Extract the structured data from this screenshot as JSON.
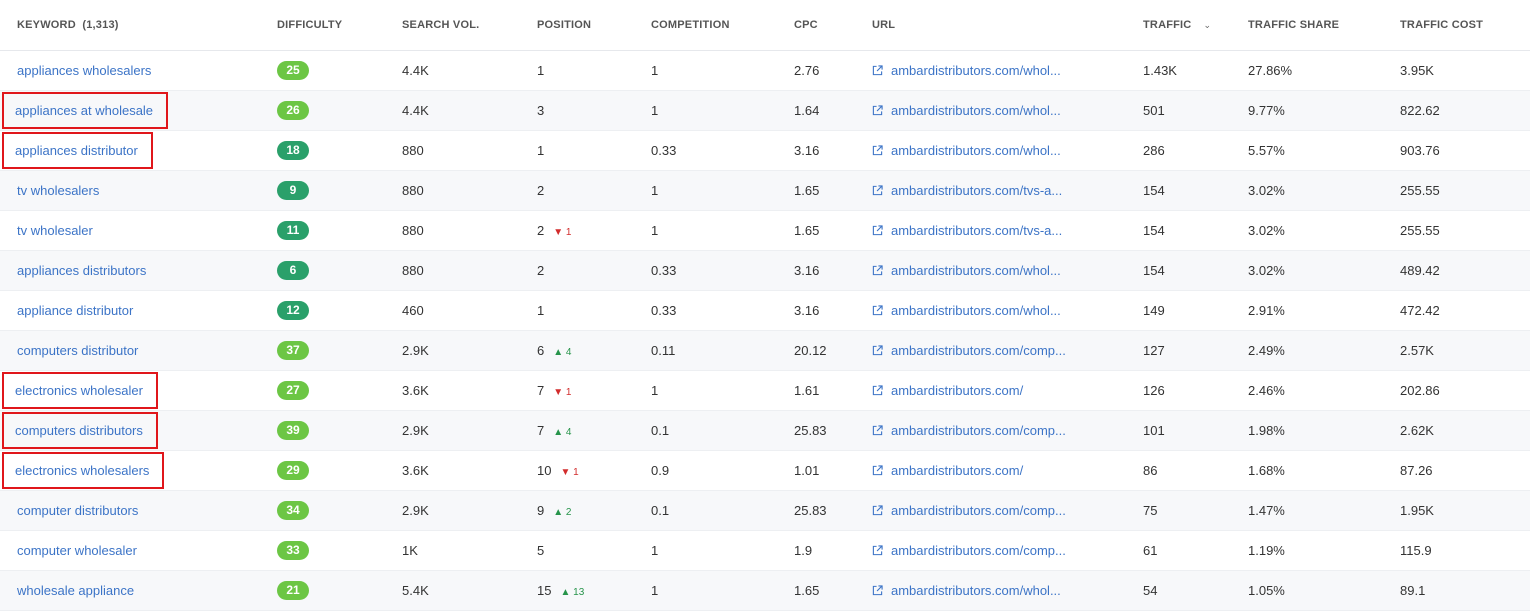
{
  "colors": {
    "accent": "#3c74c7",
    "highlight_box": "#e0161b",
    "difficulty_light": "#6cc644",
    "difficulty_dark": "#2aa06a",
    "up": "#26944a",
    "down": "#d22c2c"
  },
  "table": {
    "headers": {
      "keyword": "KEYWORD",
      "keyword_count": "(1,313)",
      "difficulty": "DIFFICULTY",
      "search_vol": "SEARCH VOL.",
      "position": "POSITION",
      "competition": "COMPETITION",
      "cpc": "CPC",
      "url": "URL",
      "traffic": "TRAFFIC",
      "traffic_share": "TRAFFIC SHARE",
      "traffic_cost": "TRAFFIC COST"
    },
    "sort_icon": "chevron-down-icon",
    "rows": [
      {
        "keyword": "appliances wholesalers",
        "difficulty": "25",
        "level": "light",
        "volume": "4.4K",
        "position": "1",
        "delta": "",
        "dir": "",
        "competition": "1",
        "cpc": "2.76",
        "url": "ambardistributors.com/whol...",
        "traffic": "1.43K",
        "share": "27.86%",
        "cost": "3.95K",
        "highlighted": false
      },
      {
        "keyword": "appliances at wholesale",
        "difficulty": "26",
        "level": "light",
        "volume": "4.4K",
        "position": "3",
        "delta": "",
        "dir": "",
        "competition": "1",
        "cpc": "1.64",
        "url": "ambardistributors.com/whol...",
        "traffic": "501",
        "share": "9.77%",
        "cost": "822.62",
        "highlighted": true
      },
      {
        "keyword": "appliances distributor",
        "difficulty": "18",
        "level": "dark",
        "volume": "880",
        "position": "1",
        "delta": "",
        "dir": "",
        "competition": "0.33",
        "cpc": "3.16",
        "url": "ambardistributors.com/whol...",
        "traffic": "286",
        "share": "5.57%",
        "cost": "903.76",
        "highlighted": true
      },
      {
        "keyword": "tv wholesalers",
        "difficulty": "9",
        "level": "dark",
        "volume": "880",
        "position": "2",
        "delta": "",
        "dir": "",
        "competition": "1",
        "cpc": "1.65",
        "url": "ambardistributors.com/tvs-a...",
        "traffic": "154",
        "share": "3.02%",
        "cost": "255.55",
        "highlighted": false
      },
      {
        "keyword": "tv wholesaler",
        "difficulty": "11",
        "level": "dark",
        "volume": "880",
        "position": "2",
        "delta": "1",
        "dir": "down",
        "competition": "1",
        "cpc": "1.65",
        "url": "ambardistributors.com/tvs-a...",
        "traffic": "154",
        "share": "3.02%",
        "cost": "255.55",
        "highlighted": false
      },
      {
        "keyword": "appliances distributors",
        "difficulty": "6",
        "level": "dark",
        "volume": "880",
        "position": "2",
        "delta": "",
        "dir": "",
        "competition": "0.33",
        "cpc": "3.16",
        "url": "ambardistributors.com/whol...",
        "traffic": "154",
        "share": "3.02%",
        "cost": "489.42",
        "highlighted": false
      },
      {
        "keyword": "appliance distributor",
        "difficulty": "12",
        "level": "dark",
        "volume": "460",
        "position": "1",
        "delta": "",
        "dir": "",
        "competition": "0.33",
        "cpc": "3.16",
        "url": "ambardistributors.com/whol...",
        "traffic": "149",
        "share": "2.91%",
        "cost": "472.42",
        "highlighted": false
      },
      {
        "keyword": "computers distributor",
        "difficulty": "37",
        "level": "light",
        "volume": "2.9K",
        "position": "6",
        "delta": "4",
        "dir": "up",
        "competition": "0.11",
        "cpc": "20.12",
        "url": "ambardistributors.com/comp...",
        "traffic": "127",
        "share": "2.49%",
        "cost": "2.57K",
        "highlighted": false
      },
      {
        "keyword": "electronics wholesaler",
        "difficulty": "27",
        "level": "light",
        "volume": "3.6K",
        "position": "7",
        "delta": "1",
        "dir": "down",
        "competition": "1",
        "cpc": "1.61",
        "url": "ambardistributors.com/",
        "traffic": "126",
        "share": "2.46%",
        "cost": "202.86",
        "highlighted": true
      },
      {
        "keyword": "computers distributors",
        "difficulty": "39",
        "level": "light",
        "volume": "2.9K",
        "position": "7",
        "delta": "4",
        "dir": "up",
        "competition": "0.1",
        "cpc": "25.83",
        "url": "ambardistributors.com/comp...",
        "traffic": "101",
        "share": "1.98%",
        "cost": "2.62K",
        "highlighted": true
      },
      {
        "keyword": "electronics wholesalers",
        "difficulty": "29",
        "level": "light",
        "volume": "3.6K",
        "position": "10",
        "delta": "1",
        "dir": "down",
        "competition": "0.9",
        "cpc": "1.01",
        "url": "ambardistributors.com/",
        "traffic": "86",
        "share": "1.68%",
        "cost": "87.26",
        "highlighted": true
      },
      {
        "keyword": "computer distributors",
        "difficulty": "34",
        "level": "light",
        "volume": "2.9K",
        "position": "9",
        "delta": "2",
        "dir": "up",
        "competition": "0.1",
        "cpc": "25.83",
        "url": "ambardistributors.com/comp...",
        "traffic": "75",
        "share": "1.47%",
        "cost": "1.95K",
        "highlighted": false
      },
      {
        "keyword": "computer wholesaler",
        "difficulty": "33",
        "level": "light",
        "volume": "1K",
        "position": "5",
        "delta": "",
        "dir": "",
        "competition": "1",
        "cpc": "1.9",
        "url": "ambardistributors.com/comp...",
        "traffic": "61",
        "share": "1.19%",
        "cost": "115.9",
        "highlighted": false
      },
      {
        "keyword": "wholesale appliance",
        "difficulty": "21",
        "level": "light",
        "volume": "5.4K",
        "position": "15",
        "delta": "13",
        "dir": "up",
        "competition": "1",
        "cpc": "1.65",
        "url": "ambardistributors.com/whol...",
        "traffic": "54",
        "share": "1.05%",
        "cost": "89.1",
        "highlighted": false
      }
    ]
  }
}
